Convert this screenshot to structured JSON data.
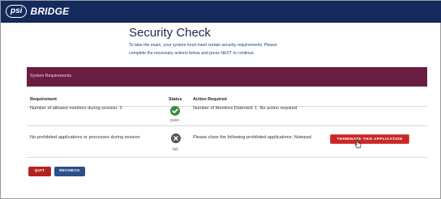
{
  "header": {
    "logo_psi": "psi",
    "logo_brand": "BRIDGE"
  },
  "page": {
    "title": "Security Check",
    "intro_line1": "To take the exam, your system must meet certain security requirements. Please",
    "intro_line2": "complete the necessary actions below and press NEXT to continue."
  },
  "panel": {
    "heading": "System Requirements",
    "columns": {
      "requirement": "Requirement",
      "status": "Status",
      "action": "Action Required"
    },
    "rows": [
      {
        "requirement": "Number of allowed monitors during session: 3",
        "status": "pass",
        "action": "Number of Monitors Detected: 1. No action required"
      },
      {
        "requirement": "No prohibited applications or processes during session",
        "status": "fail",
        "action": "Please close the following prohibited applications: Notepad",
        "button": "TERMINATE THIS APPLICATION"
      }
    ]
  },
  "buttons": {
    "quit": "QUIT",
    "recheck": "RECHECK"
  },
  "colors": {
    "topbar": "#142a5c",
    "panel_header": "#6a1c42",
    "pass": "#3d8a3d",
    "terminate": "#c62828",
    "quit": "#b42323",
    "recheck": "#2d4f8a"
  },
  "icons": {
    "pass": "check-circle-icon",
    "fail": "x-circle-icon",
    "cursor": "hand-pointer-icon"
  }
}
